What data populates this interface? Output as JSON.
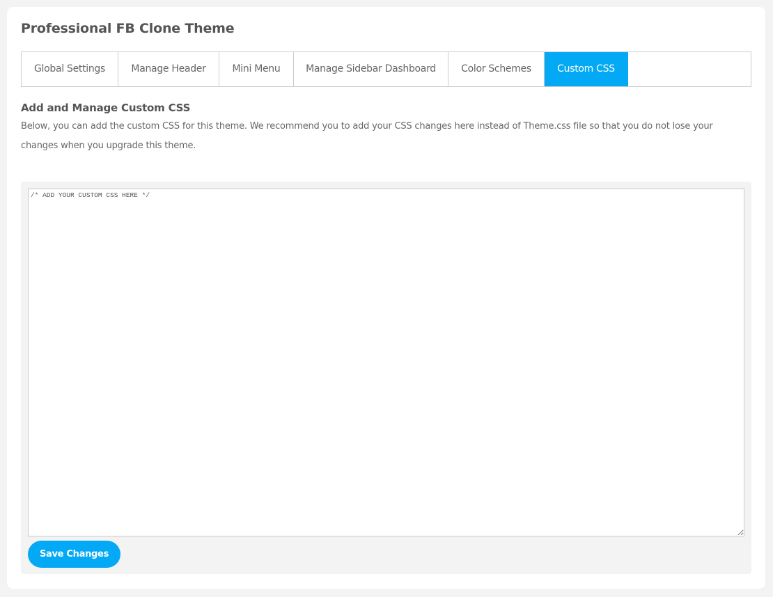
{
  "page": {
    "title": "Professional FB Clone Theme"
  },
  "tabs": [
    {
      "label": "Global Settings",
      "active": false
    },
    {
      "label": "Manage Header",
      "active": false
    },
    {
      "label": "Mini Menu",
      "active": false
    },
    {
      "label": "Manage Sidebar Dashboard",
      "active": false
    },
    {
      "label": "Color Schemes",
      "active": false
    },
    {
      "label": "Custom CSS",
      "active": true
    }
  ],
  "section": {
    "title": "Add and Manage Custom CSS",
    "description": "Below, you can add the custom CSS for this theme. We recommend you to add your CSS changes here instead of Theme.css file so that you do not lose your changes when you upgrade this theme."
  },
  "editor": {
    "value": "/* ADD YOUR CUSTOM CSS HERE */"
  },
  "actions": {
    "save_label": "Save Changes"
  },
  "colors": {
    "accent": "#03a9f4",
    "background": "#f3f3f3",
    "text": "#555555"
  }
}
